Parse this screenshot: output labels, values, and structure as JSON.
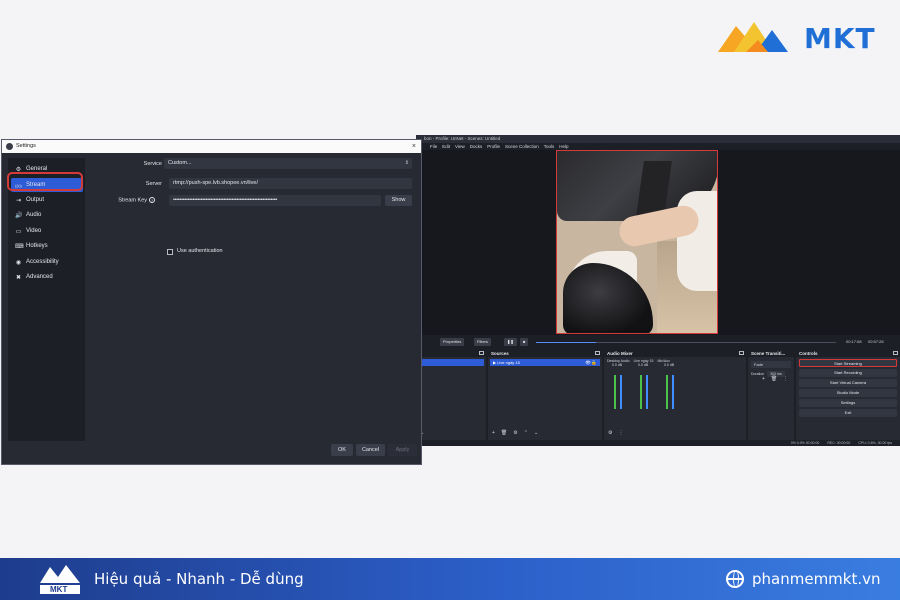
{
  "brand": {
    "logo_text": "MKT",
    "footer_logo_text": "MKT"
  },
  "obs": {
    "title": "bon - Profile: UnNet - Scenes: Untitled",
    "menu": [
      "File",
      "Edit",
      "View",
      "Docks",
      "Profile",
      "Scene Collection",
      "Tools",
      "Help"
    ],
    "transport": {
      "properties": "Properties",
      "filters": "Filters",
      "time_current": "00:17:58",
      "time_total": "00:57:28"
    },
    "docks": {
      "sources_title": "Sources",
      "source_item": "Live ngày 15",
      "mixer_title": "Audio Mixer",
      "mixer_channels": [
        "Desktop Audio",
        "Live ngày 15",
        "Mic/Aux"
      ],
      "mixer_db": [
        "0.0 dB",
        "0.0 dB",
        "0.0 dB"
      ],
      "transitions_title": "Scene Transiti...",
      "transition_value": "Fade",
      "duration_label": "Duration",
      "duration_value": "300 ms",
      "controls_title": "Controls",
      "controls": [
        "Start Streaming",
        "Start Recording",
        "Start Virtual Camera",
        "Studio Mode",
        "Settings",
        "Exit"
      ]
    },
    "status": {
      "dropped": "0% 0.0% 00:00:00",
      "rec": "REC: 00:00:00",
      "cpu": "CPU: 0.6%, 30.00 fps"
    }
  },
  "settings": {
    "title": "Settings",
    "close": "×",
    "nav": [
      {
        "label": "General",
        "icon": "⚙"
      },
      {
        "label": "Stream",
        "icon": "((•))"
      },
      {
        "label": "Output",
        "icon": "⇥"
      },
      {
        "label": "Audio",
        "icon": "🔊"
      },
      {
        "label": "Video",
        "icon": "▭"
      },
      {
        "label": "Hotkeys",
        "icon": "⌨"
      },
      {
        "label": "Accessibility",
        "icon": "◉"
      },
      {
        "label": "Advanced",
        "icon": "✖"
      }
    ],
    "service_label": "Service",
    "service_value": "Custom...",
    "server_label": "Server",
    "server_value": "rtmp://push-spe.lvb.shopee.vn/live/",
    "stream_key_label": "Stream Key",
    "stream_key_value": "••••••••••••••••••••••••••••••••••••••••••••••••••••••••••••••••",
    "show_button": "Show",
    "use_auth": "Use authentication",
    "ok": "OK",
    "cancel": "Cancel",
    "apply": "Apply"
  },
  "footer": {
    "slogan": "Hiệu quả - Nhanh - Dễ dùng",
    "url": "phanmemmkt.vn"
  },
  "colors": {
    "accent_blue": "#2e5bd6",
    "highlight_red": "#d43a3a",
    "footer_blue": "#2c5fc9"
  }
}
